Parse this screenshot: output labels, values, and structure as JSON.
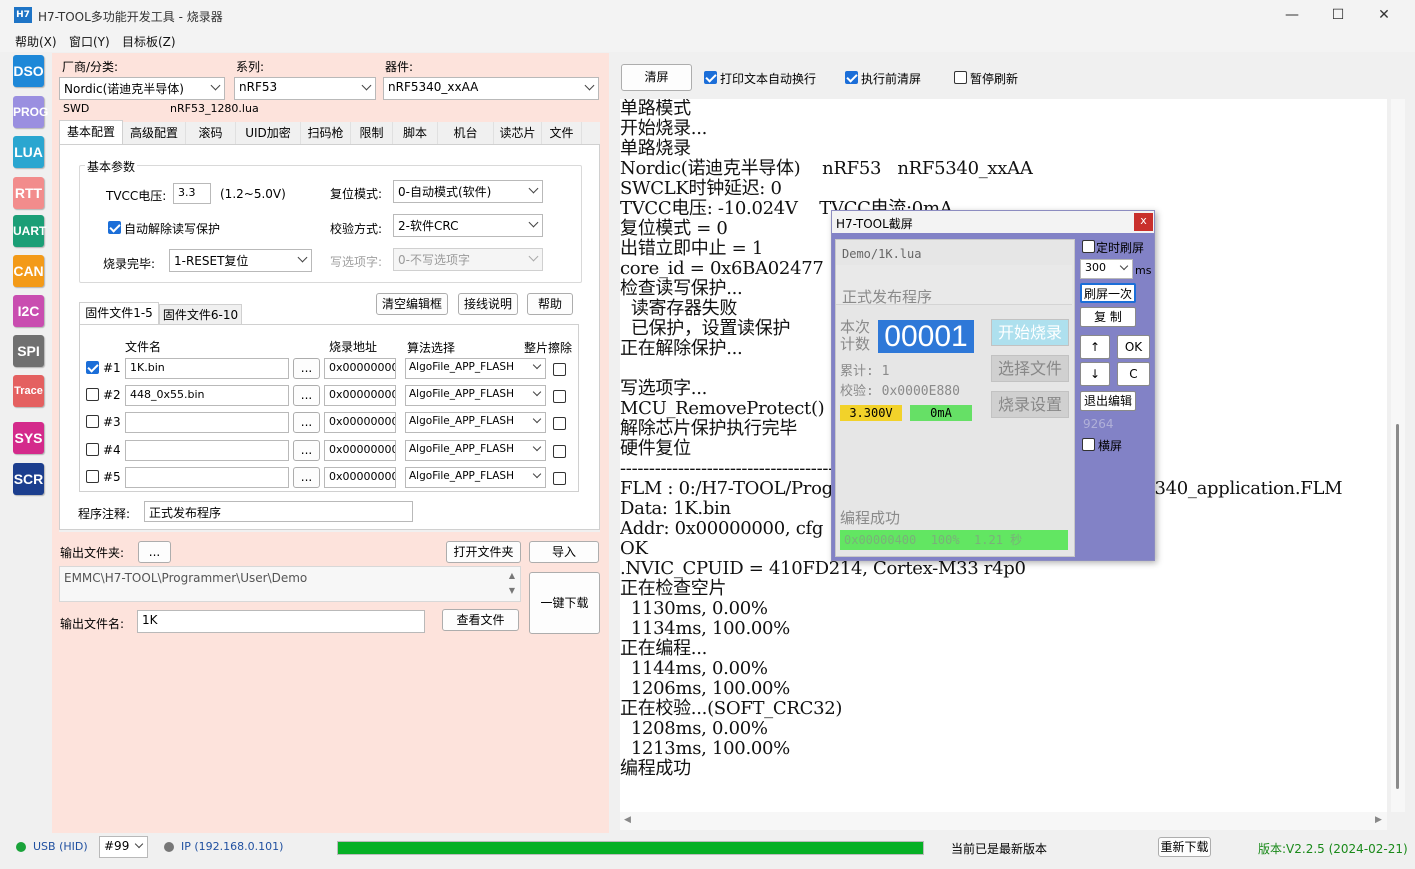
{
  "window": {
    "logo": "H7",
    "title": "H7-TOOL多功能开发工具 - 烧录器",
    "minimize": "—",
    "maximize": "☐",
    "close": "✕"
  },
  "menu": [
    "帮助(X)",
    "窗口(Y)",
    "目标板(Z)"
  ],
  "sidebar": [
    "DSO",
    "PROG",
    "LUA",
    "RTT",
    "UART",
    "CAN",
    "I2C",
    "SPI",
    "Trace",
    "SYS",
    "SCR"
  ],
  "colors": {
    "DSO": "#1e88d8",
    "PROG": "#9a8fe0",
    "LUA": "#2aa6d0",
    "RTT": "#f28c8c",
    "UART": "#1b9e76",
    "CAN": "#f39a18",
    "I2C": "#c94db0",
    "SPI": "#707070",
    "Trace": "#e46060",
    "SYS": "#d42a8b",
    "SCR": "#1c3e8e"
  },
  "device": {
    "vendor_label": "厂商/分类:",
    "vendor": "Nordic(诺迪克半导体)",
    "series_label": "系列:",
    "series": "nRF53",
    "part_label": "器件:",
    "part": "nRF5340_xxAA",
    "iface": "SWD",
    "script": "nRF53_1280.lua"
  },
  "tabs": [
    "基本配置",
    "高级配置",
    "滚码",
    "UID加密",
    "扫码枪",
    "限制",
    "脚本",
    "机台",
    "读芯片",
    "文件"
  ],
  "basic": {
    "group": "基本参数",
    "tvcc_label": "TVCC电压:",
    "tvcc": "3.3",
    "tvcc_range": "(1.2~5.0V)",
    "reset_label": "复位模式:",
    "reset": "0-自动模式(软件)",
    "auto_unprotect": "自动解除读写保护",
    "verify_label": "校验方式:",
    "verify": "2-软件CRC",
    "done_label": "烧录完毕:",
    "done": "1-RESET复位",
    "opt_label": "写选项字:",
    "opt": "0-不写选项字"
  },
  "fw": {
    "tab1": "固件文件1-5",
    "tab2": "固件文件6-10",
    "clear": "清空编辑框",
    "wiring": "接线说明",
    "help": "帮助",
    "col_name": "文件名",
    "col_addr": "烧录地址",
    "col_algo": "算法选择",
    "col_erase": "整片擦除",
    "browse": "...",
    "rows": [
      {
        "id": "#1",
        "checked": true,
        "file": "1K.bin",
        "addr": "0x00000000",
        "algo": "AlgoFile_APP_FLASH"
      },
      {
        "id": "#2",
        "checked": false,
        "file": "448_0x55.bin",
        "addr": "0x00000000",
        "algo": "AlgoFile_APP_FLASH"
      },
      {
        "id": "#3",
        "checked": false,
        "file": "",
        "addr": "0x00000000",
        "algo": "AlgoFile_APP_FLASH"
      },
      {
        "id": "#4",
        "checked": false,
        "file": "",
        "addr": "0x00000000",
        "algo": "AlgoFile_APP_FLASH"
      },
      {
        "id": "#5",
        "checked": false,
        "file": "",
        "addr": "0x00000000",
        "algo": "AlgoFile_APP_FLASH"
      }
    ],
    "note_label": "程序注释:",
    "note": "正式发布程序"
  },
  "output": {
    "folder_label": "输出文件夹:",
    "browse": "...",
    "open_folder": "打开文件夹",
    "import": "导入",
    "path": "EMMC\\H7-TOOL\\Programmer\\User\\Demo",
    "download": "一键下载",
    "name_label": "输出文件名:",
    "name": "1K",
    "view": "查看文件"
  },
  "console_bar": {
    "clear": "清屏",
    "wrap": "打印文本自动换行",
    "clear_before": "执行前清屏",
    "pause": "暂停刷新"
  },
  "console": [
    "单路模式",
    "开始烧录...",
    "单路烧录",
    "Nordic(诺迪克半导体)    nRF53   nRF5340_xxAA",
    "SWCLK时钟延迟: 0",
    "TVCC电压: -10.024V    TVCC电流:0mA",
    "复位模式 = 0",
    "出错立即中止 = 1",
    "core_id = 0x6BA02477",
    "检查读写保护...",
    "  读寄存器失败",
    "  已保护，设置读保护",
    "正在解除保护...",
    "",
    "写选项字...",
    "MCU_RemoveProtect()",
    "解除芯片保护执行完毕",
    "硬件复位",
    "-----------------------------------------------------------------",
    "FLM : 0:/H7-TOOL/Programmer/Device/Nordic/nRF53/nRF5340_application.FLM",
    "Data: 1K.bin",
    "Addr: 0x00000000, cfg",
    "OK",
    ".NVIC_CPUID = 410FD214, Cortex-M33 r4p0",
    "正在检查空片",
    "  1130ms, 0.00%",
    "  1134ms, 100.00%",
    "正在编程...",
    "  1144ms, 0.00%",
    "  1206ms, 100.00%",
    "正在校验...(SOFT_CRC32)",
    "  1208ms, 0.00%",
    "  1213ms, 100.00%",
    "编程成功"
  ],
  "screen": {
    "title": "H7-TOOL截屏",
    "close": "x",
    "script": "Demo/1K.lua",
    "note": "正式发布程序",
    "count_label1": "本次",
    "count_label2": "计数",
    "count": "00001",
    "btn_start": "开始烧录",
    "btn_select": "选择文件",
    "btn_settings": "烧录设置",
    "total": "累计: 1",
    "checksum": "校验: 0x0000E880",
    "volt": "3.300V",
    "curr": "0mA",
    "status": "编程成功",
    "progress": "0x00000400  100%  1.21 秒",
    "timed": "定时刷屏",
    "interval": "300",
    "ms": "ms",
    "refresh": "刷屏一次",
    "copy": "复 制",
    "up": "↑",
    "ok": "OK",
    "down": "↓",
    "c": "C",
    "exit_edit": "退出编辑",
    "num": "9264",
    "landscape": "横屏"
  },
  "statusbar": {
    "usb": "USB (HID)",
    "slot": "#99",
    "ip": "IP (192.168.0.101)",
    "progress_pct": 100,
    "latest": "当前已是最新版本",
    "redownload": "重新下载",
    "version": "版本:V2.2.5 (2024-02-21)"
  }
}
